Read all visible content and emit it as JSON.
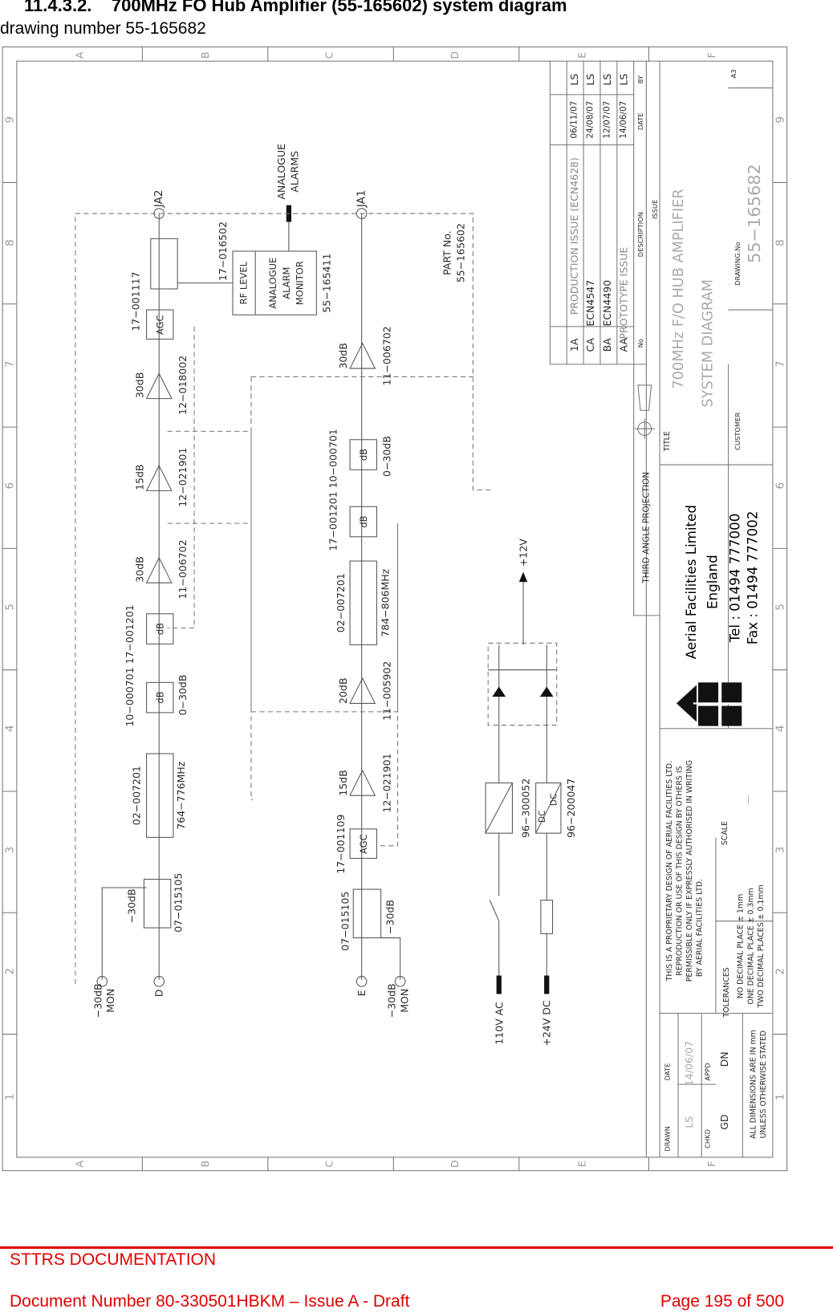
{
  "header": {
    "section": "11.4.3.2.    700MHz FO Hub Amplifier (55-165602) system diagram",
    "subtitle": "drawing number 55-165682"
  },
  "footer": {
    "org": "STTRS DOCUMENTATION",
    "doc": "Document Number 80-330501HBKM – Issue A - Draft",
    "page": "Page 195 of 500",
    "rule_color": "#e00000"
  },
  "drawing": {
    "cols": [
      "A",
      "B",
      "C",
      "D",
      "E",
      "F"
    ],
    "rows": [
      "1",
      "2",
      "3",
      "4",
      "5",
      "6",
      "7",
      "8",
      "9"
    ],
    "ja2": "JA2",
    "ja1": "JA1",
    "d": "D",
    "e": "E",
    "mon_db_a": "−30dB",
    "mon_a": "MON",
    "mon_db_b": "−30dB",
    "mon_b": "MON",
    "u_cpl_db": "−30dB",
    "u_cpl_pn": "07−015105",
    "u_filt_pn": "02−007201",
    "u_filt_f": "764−776MHz",
    "u_att_pn": "10−000701 17−001201",
    "u_db1": "dB",
    "u_db2": "dB",
    "u_att_r": "0−30dB",
    "u_a1_g": "30dB",
    "u_a1_pn": "11−006702",
    "u_a2_g": "15dB",
    "u_a2_pn": "12−021901",
    "u_a3_g": "30dB",
    "u_a3_pn": "12−018002",
    "u_agc_pn": "17−001117",
    "u_agc": "AGC",
    "u_cpl2_pn": "17−016502",
    "rf_level": "RF LEVEL",
    "mon1": "ANALOGUE",
    "mon2": "ALARM",
    "mon3": "MONITOR",
    "mon_pn": "55−165411",
    "alarms1": "ANALOGUE",
    "alarms2": "ALARMS",
    "part1": "PART No.",
    "part2": "55−165602",
    "l_a1_g": "30dB",
    "l_a1_pn": "11−006702",
    "l_att_pn": "17−001201 10−000701",
    "l_db1": "dB",
    "l_db2": "dB",
    "l_att_r": "0−30dB",
    "l_filt_pn": "02−007201",
    "l_filt_f": "784−806MHz",
    "l_a2_g": "20dB",
    "l_a2_pn": "11−005902",
    "l_a3_g": "15dB",
    "l_a3_pn": "12−021901",
    "l_agc_pn": "17−001109",
    "l_agc": "AGC",
    "l_cpl_pn": "07−015105",
    "l_cpl_db": "−30dB",
    "ac_in": "110V AC",
    "dc_in": "+24V DC",
    "psu1_pn": "96−300052",
    "psu2_pn": "96−200047",
    "dc1": "DC",
    "dc2": "DC",
    "plus12": "+12V",
    "projection": "THIRD ANGLE PROJECTION",
    "title_lbl": "TITLE",
    "title1": "700MHz F/O HUB AMPLIFIER",
    "title2": "SYSTEM DIAGRAM",
    "customer_lbl": "CUSTOMER",
    "drawing_no_lbl": "DRAWING.No",
    "drawing_no": "55−165682",
    "sheet": "A3",
    "company": "Aerial Facilities Limited",
    "country": "England",
    "tel": "Tel : 01494 777000",
    "fax": "Fax : 01494 777002",
    "prop1": "THIS IS A PROPRIETARY DESIGN OF AERIAL FACILITIES LTD.",
    "prop2": "REPRODUCTION OR USE OF THIS DESIGN BY OTHERS IS",
    "prop3": "PERMISSIBLE ONLY IF EXPRESSLY AUTHORISED IN WRITING",
    "prop4": "BY AERIAL FACILITIES LTD.",
    "tol_lbl": "TOLERANCES",
    "tol1": "NO DECIMAL PLACE ± 1mm",
    "tol2": "ONE DECIMAL PLACE ± 0.3mm",
    "tol3": "TWO DECIMAL PLACES ± 0.1mm",
    "scale_lbl": "SCALE",
    "scale": "—",
    "drawn_lbl": "DRAWN",
    "drawn": "LS",
    "chkd_lbl": "CHKD",
    "chkd": "GD",
    "date_lbl": "DATE",
    "date": "14/06/07",
    "appd_lbl": "APPD",
    "appd": "DN",
    "dims1": "ALL DIMENSIONS ARE IN mm",
    "dims2": "UNLESS OTHERWISE STATED",
    "issue_lbl": "ISSUE",
    "rev_hdr": {
      "no": "No",
      "desc": "DESCRIPTION",
      "date": "DATE",
      "by": "BY"
    },
    "revisions": [
      {
        "no": "1A",
        "desc": "PRODUCTION ISSUE (ECN4628)",
        "date": "06/11/07",
        "by": "LS"
      },
      {
        "no": "CA",
        "desc": "ECN4547",
        "date": "24/08/07",
        "by": "LS"
      },
      {
        "no": "BA",
        "desc": "ECN4490",
        "date": "12/07/07",
        "by": "LS"
      },
      {
        "no": "AA",
        "desc": "PROTOTYPE ISSUE",
        "date": "14/06/07",
        "by": "LS"
      }
    ]
  }
}
